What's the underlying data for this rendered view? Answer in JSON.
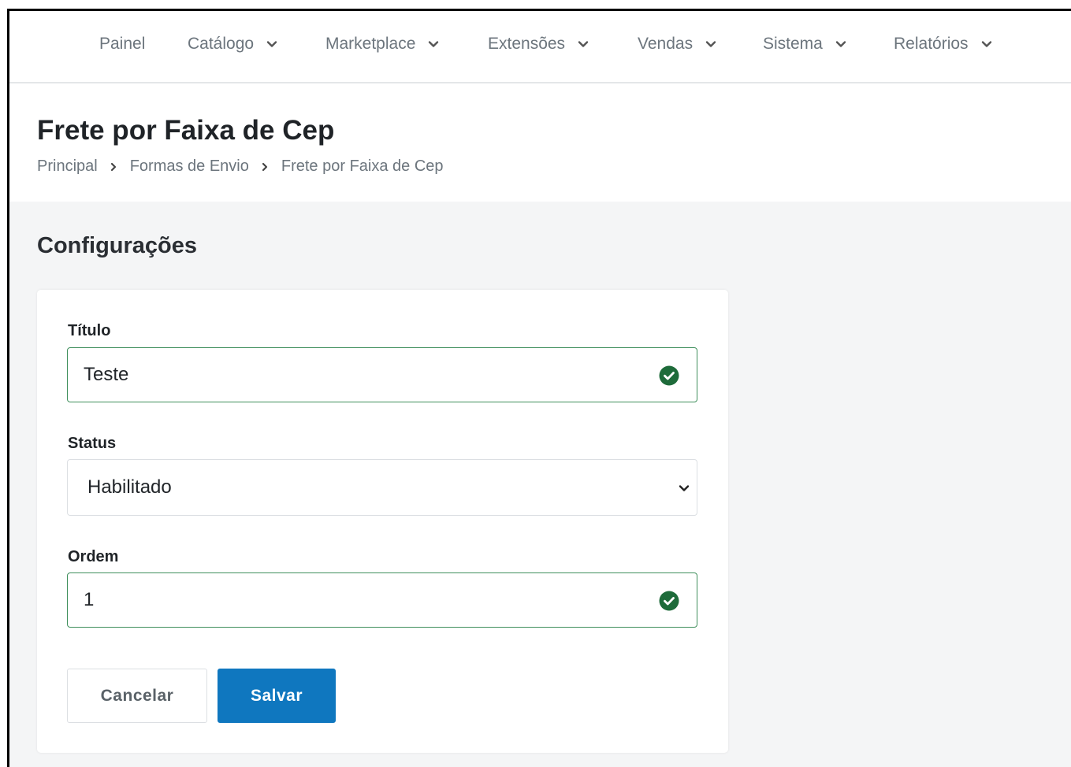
{
  "nav": {
    "items": [
      {
        "label": "Painel",
        "has_dropdown": false
      },
      {
        "label": "Catálogo",
        "has_dropdown": true
      },
      {
        "label": "Marketplace",
        "has_dropdown": true
      },
      {
        "label": "Extensões",
        "has_dropdown": true
      },
      {
        "label": "Vendas",
        "has_dropdown": true
      },
      {
        "label": "Sistema",
        "has_dropdown": true
      },
      {
        "label": "Relatórios",
        "has_dropdown": true
      }
    ]
  },
  "header": {
    "title": "Frete por Faixa de Cep",
    "breadcrumb": [
      "Principal",
      "Formas de Envio",
      "Frete por Faixa de Cep"
    ]
  },
  "section": {
    "title": "Configurações"
  },
  "form": {
    "titulo": {
      "label": "Título",
      "value": "Teste",
      "valid": true
    },
    "status": {
      "label": "Status",
      "value": "Habilitado"
    },
    "ordem": {
      "label": "Ordem",
      "value": "1",
      "valid": true
    }
  },
  "actions": {
    "cancel_label": "Cancelar",
    "save_label": "Salvar"
  },
  "colors": {
    "accent": "#0f77bf",
    "valid": "#1e6b3a",
    "nav_text": "#6c757d",
    "page_bg": "#f4f5f6"
  },
  "icons": {
    "dropdown": "chevron-down-icon",
    "breadcrumb_separator": "chevron-right-icon",
    "valid": "check-circle-icon"
  }
}
